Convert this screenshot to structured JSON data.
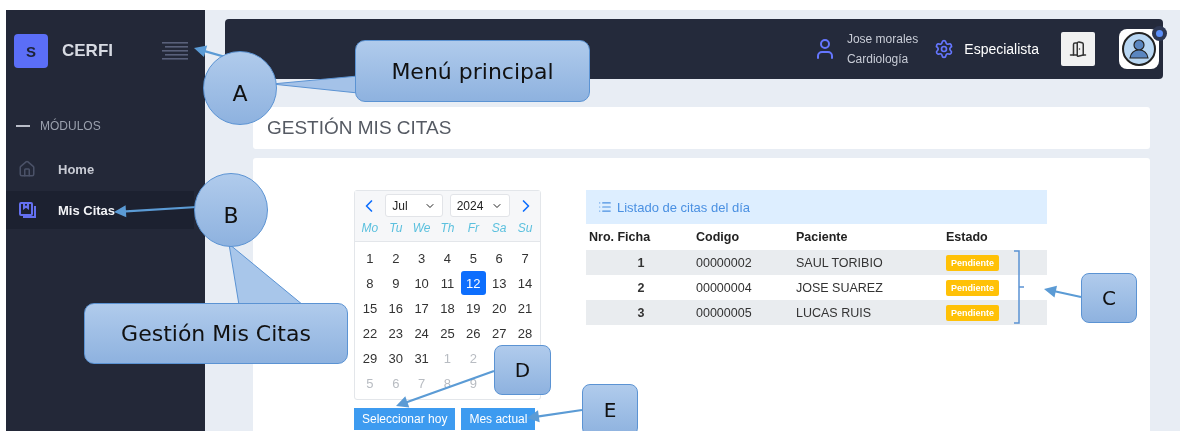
{
  "sidebar": {
    "brand_letter": "S",
    "brand_name": "CERFI",
    "section": "MÓDULOS",
    "items": [
      {
        "label": "Home",
        "selected": false
      },
      {
        "label": "Mis Citas",
        "selected": true
      }
    ]
  },
  "header": {
    "user_name": "Jose morales",
    "user_specialty": "Cardiología",
    "role": "Especialista",
    "avatar_dot": true
  },
  "page_title": "GESTIÓN MIS CITAS",
  "calendar": {
    "month": "Jul",
    "year": "2024",
    "weekdays": [
      "Mo",
      "Tu",
      "We",
      "Th",
      "Fr",
      "Sa",
      "Su"
    ],
    "weeks": [
      [
        {
          "day": "1",
          "muted": false,
          "selected": false
        },
        {
          "day": "2",
          "muted": false,
          "selected": false
        },
        {
          "day": "3",
          "muted": false,
          "selected": false
        },
        {
          "day": "4",
          "muted": false,
          "selected": false
        },
        {
          "day": "5",
          "muted": false,
          "selected": false
        },
        {
          "day": "6",
          "muted": false,
          "selected": false
        },
        {
          "day": "7",
          "muted": false,
          "selected": false
        }
      ],
      [
        {
          "day": "8",
          "muted": false,
          "selected": false
        },
        {
          "day": "9",
          "muted": false,
          "selected": false
        },
        {
          "day": "10",
          "muted": false,
          "selected": false
        },
        {
          "day": "11",
          "muted": false,
          "selected": false
        },
        {
          "day": "12",
          "muted": false,
          "selected": true
        },
        {
          "day": "13",
          "muted": false,
          "selected": false
        },
        {
          "day": "14",
          "muted": false,
          "selected": false
        }
      ],
      [
        {
          "day": "15",
          "muted": false,
          "selected": false
        },
        {
          "day": "16",
          "muted": false,
          "selected": false
        },
        {
          "day": "17",
          "muted": false,
          "selected": false
        },
        {
          "day": "18",
          "muted": false,
          "selected": false
        },
        {
          "day": "19",
          "muted": false,
          "selected": false
        },
        {
          "day": "20",
          "muted": false,
          "selected": false
        },
        {
          "day": "21",
          "muted": false,
          "selected": false
        }
      ],
      [
        {
          "day": "22",
          "muted": false,
          "selected": false
        },
        {
          "day": "23",
          "muted": false,
          "selected": false
        },
        {
          "day": "24",
          "muted": false,
          "selected": false
        },
        {
          "day": "25",
          "muted": false,
          "selected": false
        },
        {
          "day": "26",
          "muted": false,
          "selected": false
        },
        {
          "day": "27",
          "muted": false,
          "selected": false
        },
        {
          "day": "28",
          "muted": false,
          "selected": false
        }
      ],
      [
        {
          "day": "29",
          "muted": false,
          "selected": false
        },
        {
          "day": "30",
          "muted": false,
          "selected": false
        },
        {
          "day": "31",
          "muted": false,
          "selected": false
        },
        {
          "day": "1",
          "muted": true,
          "selected": false
        },
        {
          "day": "2",
          "muted": true,
          "selected": false
        }
      ],
      [
        {
          "day": "5",
          "muted": true,
          "selected": false
        },
        {
          "day": "6",
          "muted": true,
          "selected": false
        },
        {
          "day": "7",
          "muted": true,
          "selected": false
        },
        {
          "day": "8",
          "muted": true,
          "selected": false
        },
        {
          "day": "9",
          "muted": true,
          "selected": false
        }
      ]
    ],
    "buttons": [
      "Seleccionar hoy",
      "Mes actual"
    ]
  },
  "appointments": {
    "title": "Listado de citas del día",
    "columns": [
      "Nro. Ficha",
      "Codigo",
      "Paciente",
      "Estado"
    ],
    "rows": [
      {
        "number": "1",
        "code": "00000002",
        "patient": "SAUL TORIBIO",
        "status": "Pendiente"
      },
      {
        "number": "2",
        "code": "00000004",
        "patient": "JOSE SUAREZ",
        "status": "Pendiente"
      },
      {
        "number": "3",
        "code": "00000005",
        "patient": "LUCAS RUIS",
        "status": "Pendiente"
      }
    ]
  },
  "annotations": [
    {
      "kind": "circle",
      "label": "A"
    },
    {
      "kind": "bubble",
      "label": "Menú principal"
    },
    {
      "kind": "circle",
      "label": "B"
    },
    {
      "kind": "bubble",
      "label": "Gestión Mis Citas"
    },
    {
      "kind": "box",
      "label": "C"
    },
    {
      "kind": "box",
      "label": "D"
    },
    {
      "kind": "box",
      "label": "E"
    }
  ]
}
